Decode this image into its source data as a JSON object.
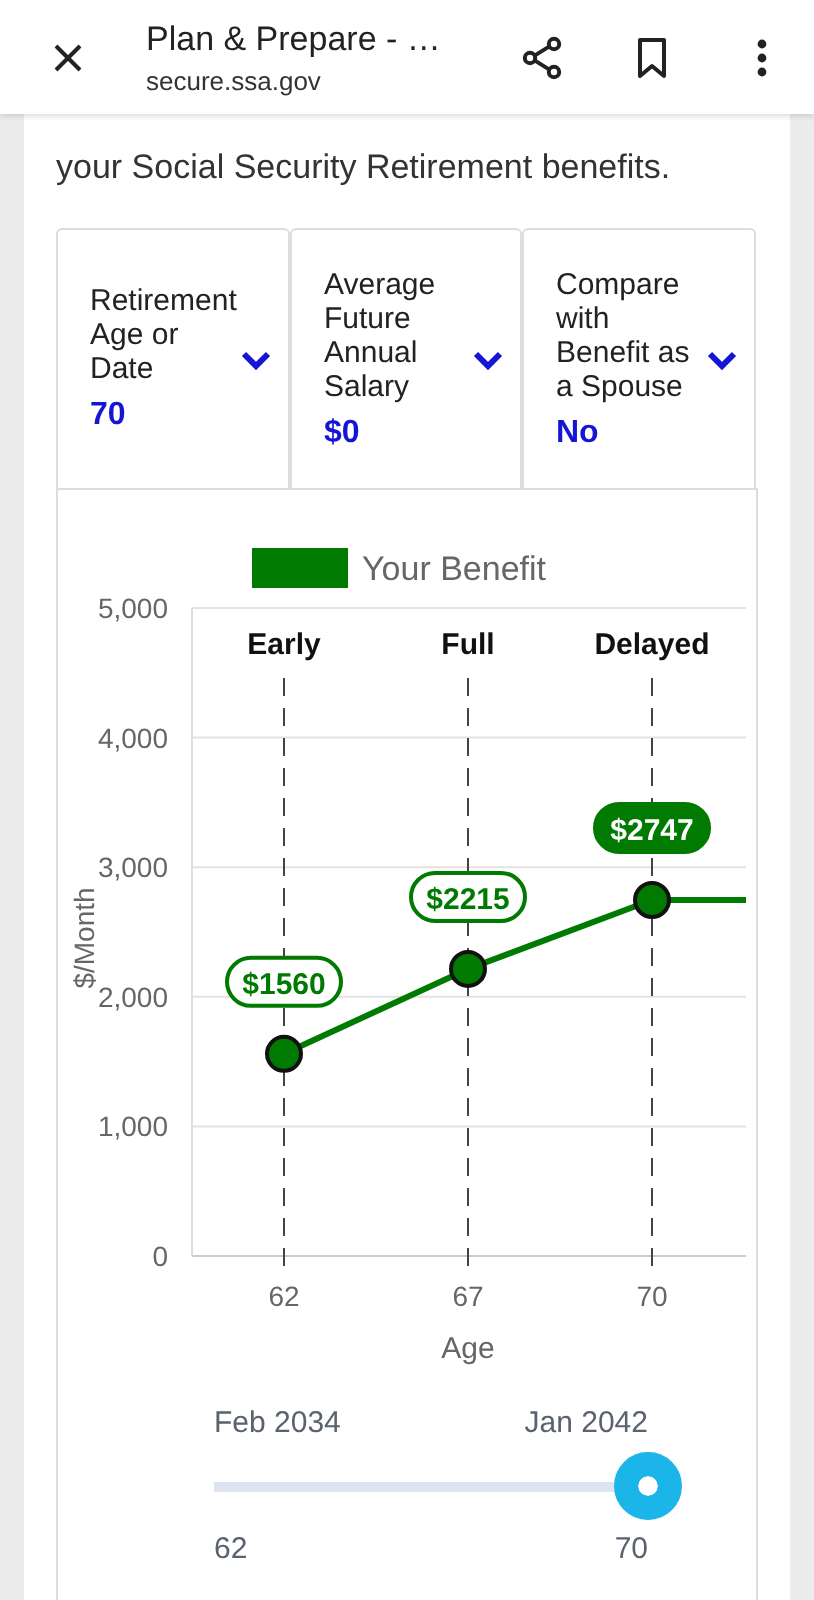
{
  "header": {
    "title": "Plan & Prepare - …",
    "url": "secure.ssa.gov"
  },
  "intro": [
    "your Social Security Retirement benefits."
  ],
  "selectors": [
    {
      "label": "Retirement Age or Date",
      "value": "70"
    },
    {
      "label": "Average Future Annual Salary",
      "value": "$0"
    },
    {
      "label": "Compare with Benefit as a Spouse",
      "value": "No"
    }
  ],
  "chart": {
    "phases": [
      "Early",
      "Full",
      "Delayed"
    ],
    "value_badges": [
      {
        "text": "$1560",
        "selected": false
      },
      {
        "text": "$2215",
        "selected": false
      },
      {
        "text": "$2747",
        "selected": true
      }
    ],
    "chart_data": {
      "type": "line",
      "xlabel": "Age",
      "ylabel": "$/Month",
      "categories": [
        "62",
        "67",
        "70"
      ],
      "series": [
        {
          "name": "Your Benefit",
          "color": "#007a00",
          "marker": "circle",
          "values": [
            1560,
            2215,
            2747
          ]
        }
      ],
      "grid": true,
      "ref_lines": [
        {
          "axis": "y",
          "value": 2747
        }
      ],
      "ylim": [
        0,
        5000
      ],
      "yticks": [
        {
          "value": 0,
          "label": "0"
        },
        {
          "value": 1000,
          "label": "1,000"
        },
        {
          "value": 2000,
          "label": "2,000"
        },
        {
          "value": 3000,
          "label": "3,000"
        },
        {
          "value": 4000,
          "label": "4,000"
        },
        {
          "value": 5000,
          "label": "5,000"
        }
      ]
    }
  },
  "slider": {
    "start_date": "Feb 2034",
    "end_date": "Jan 2042",
    "min_label": "62",
    "max_label": "70",
    "level": 1
  }
}
